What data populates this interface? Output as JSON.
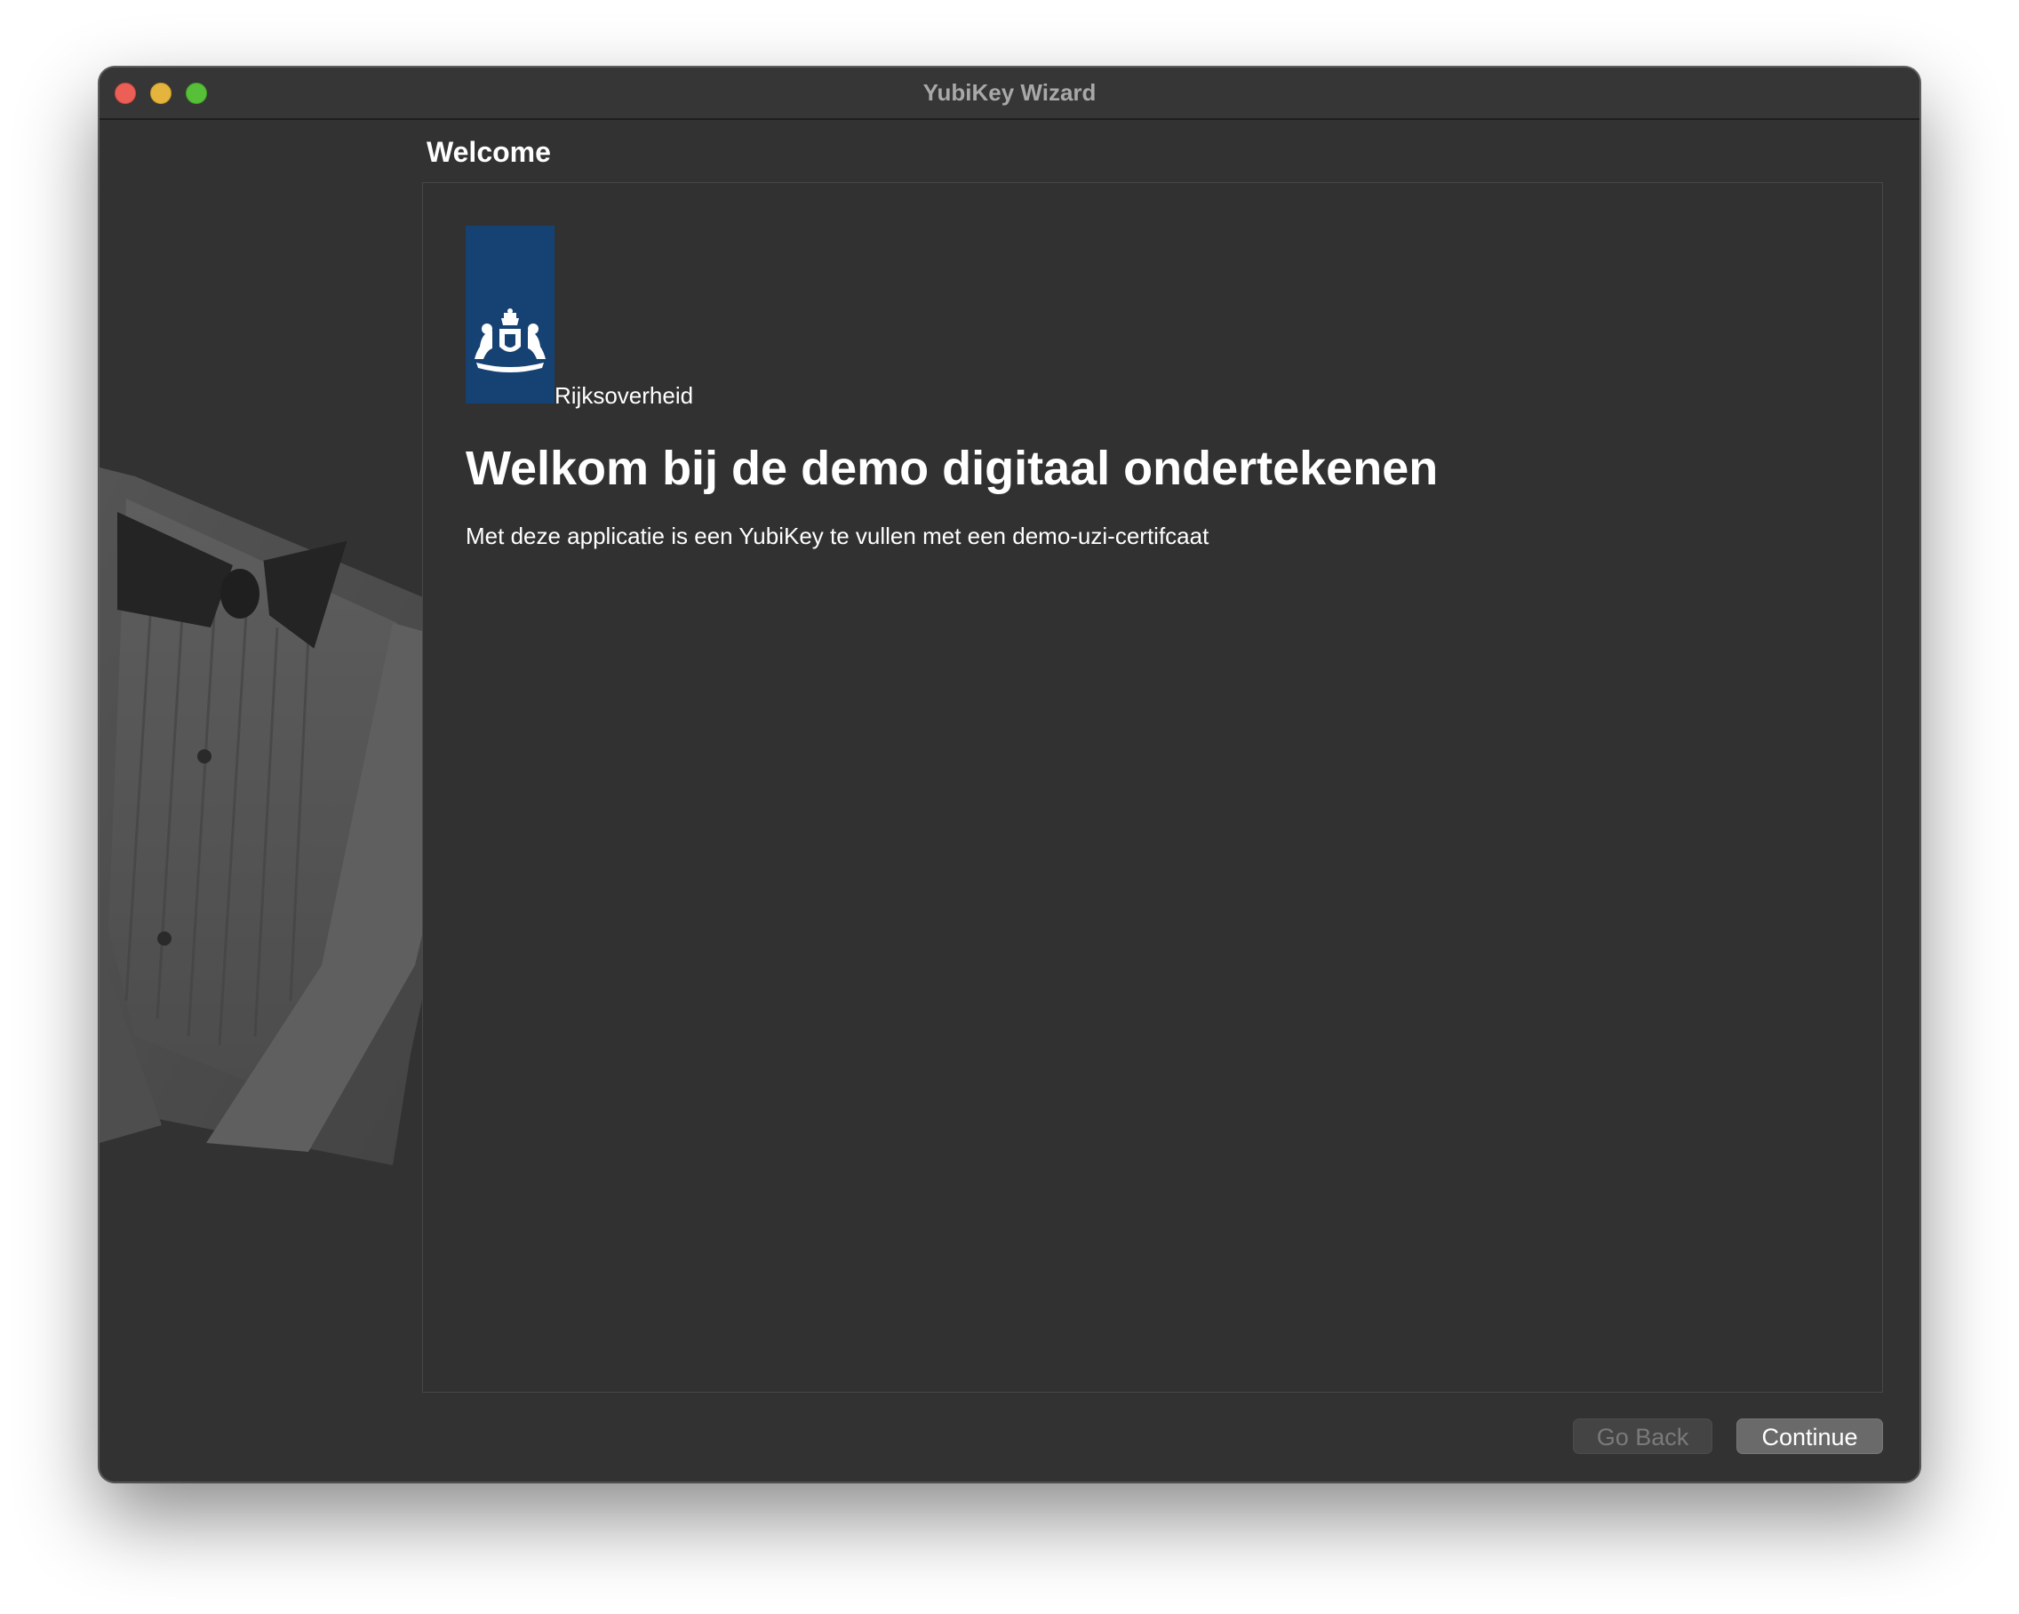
{
  "window": {
    "title": "YubiKey Wizard"
  },
  "step": {
    "title": "Welcome"
  },
  "logo": {
    "name": "Rijksoverheid",
    "icon": "coat-of-arms-icon",
    "color": "#154273"
  },
  "content": {
    "heading": "Welkom bij de demo digitaal ondertekenen",
    "description": "Met deze applicatie is een YubiKey te vullen met een demo-uzi-certifcaat"
  },
  "buttons": {
    "back_label": "Go Back",
    "back_enabled": false,
    "continue_label": "Continue"
  },
  "colors": {
    "window_bg": "#323232",
    "close": "#ec5f57",
    "minimize": "#e4b43c",
    "zoom": "#57c038"
  }
}
